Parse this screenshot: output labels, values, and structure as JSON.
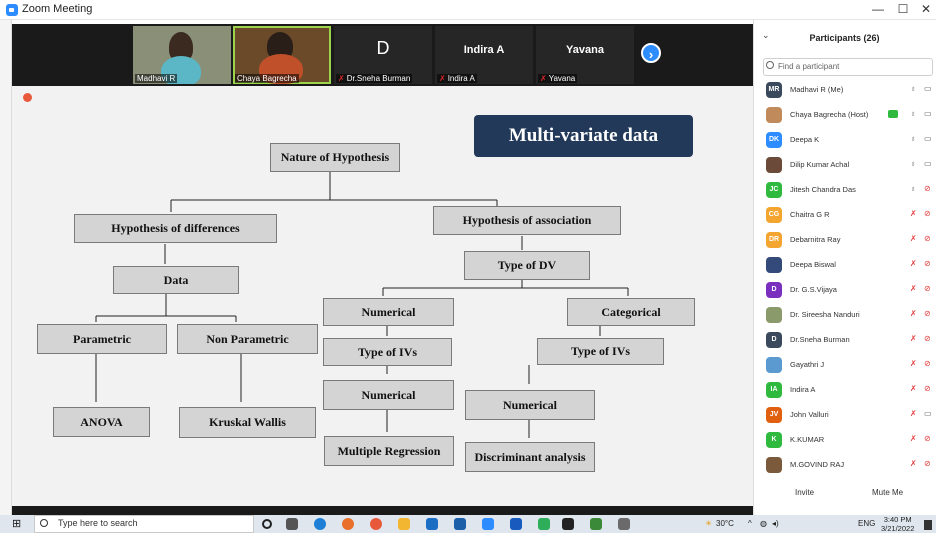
{
  "window": {
    "title": "Zoom Meeting",
    "minimize": "—",
    "maximize": "☐",
    "close": "✕"
  },
  "videos": [
    {
      "name": "Madhavi R",
      "muted": false,
      "avatar_letter": ""
    },
    {
      "name": "Chaya Bagrecha",
      "muted": false,
      "avatar_letter": ""
    },
    {
      "name": "Dr.Sneha Burman",
      "muted": true,
      "avatar_letter": "D"
    },
    {
      "name": "Indira A",
      "muted": true,
      "avatar_letter": "",
      "big": "Indira A"
    },
    {
      "name": "Yavana",
      "muted": true,
      "avatar_letter": "",
      "big": "Yavana"
    }
  ],
  "next_icon": "›",
  "slide": {
    "banner": "Multi-variate data",
    "nodes": {
      "nature": "Nature of Hypothesis",
      "differences": "Hypothesis of differences",
      "association": "Hypothesis of association",
      "data": "Data",
      "type_dv": "Type of DV",
      "numerical1": "Numerical",
      "categorical": "Categorical",
      "parametric": "Parametric",
      "nonparametric": "Non Parametric",
      "type_ivs1": "Type of IVs",
      "type_ivs2": "Type of IVs",
      "numerical2": "Numerical",
      "numerical3": "Numerical",
      "anova": "ANOVA",
      "kruskal": "Kruskal Wallis",
      "multiple_regression": "Multiple Regression",
      "discriminant": "Discriminant analysis"
    }
  },
  "participants": {
    "header": "Participants (26)",
    "search_placeholder": "Find a participant",
    "list": [
      {
        "initials": "MR",
        "name": "Madhavi R (Me)",
        "color": "#3a4a5c",
        "mic": "on",
        "video": "on"
      },
      {
        "initials": "",
        "name": "Chaya Bagrecha (Host)",
        "color": "#c08a5a",
        "mic": "on",
        "video": "on",
        "sharing": true
      },
      {
        "initials": "DK",
        "name": "Deepa K",
        "color": "#2d8cff",
        "mic": "on",
        "video": "on"
      },
      {
        "initials": "",
        "name": "Dilip Kumar Achal",
        "color": "#6b4a3a",
        "mic": "on",
        "video": "on"
      },
      {
        "initials": "JC",
        "name": "Jitesh Chandra Das",
        "color": "#2fba3f",
        "mic": "on",
        "video": "off"
      },
      {
        "initials": "CG",
        "name": "Chaitra G R",
        "color": "#f3a530",
        "mic": "off",
        "video": "off"
      },
      {
        "initials": "DR",
        "name": "Debarnitra Ray",
        "color": "#f3a530",
        "mic": "off",
        "video": "off"
      },
      {
        "initials": "",
        "name": "Deepa Biswal",
        "color": "#334a7a",
        "mic": "off",
        "video": "off"
      },
      {
        "initials": "D",
        "name": "Dr. G.S.Vijaya",
        "color": "#7a2fbf",
        "mic": "off",
        "video": "off"
      },
      {
        "initials": "",
        "name": "Dr. Sireesha Nanduri",
        "color": "#8a9a6a",
        "mic": "off",
        "video": "off"
      },
      {
        "initials": "D",
        "name": "Dr.Sneha Burman",
        "color": "#3a4a5c",
        "mic": "off",
        "video": "off"
      },
      {
        "initials": "",
        "name": "Gayathri J",
        "color": "#5a9ad0",
        "mic": "off",
        "video": "off"
      },
      {
        "initials": "IA",
        "name": "Indira A",
        "color": "#2fba3f",
        "mic": "off",
        "video": "off"
      },
      {
        "initials": "JV",
        "name": "John Valluri",
        "color": "#e06010",
        "mic": "off",
        "video": "on"
      },
      {
        "initials": "K",
        "name": "K.KUMAR",
        "color": "#2fba3f",
        "mic": "off",
        "video": "off"
      },
      {
        "initials": "",
        "name": "M.GOVIND RAJ",
        "color": "#7a5a3a",
        "mic": "off",
        "video": "off"
      }
    ],
    "invite": "Invite",
    "mute_me": "Mute Me"
  },
  "taskbar": {
    "search_placeholder": "Type here to search",
    "weather": "30°C",
    "lang": "ENG",
    "time": "3:40 PM",
    "date": "3/21/2022"
  }
}
